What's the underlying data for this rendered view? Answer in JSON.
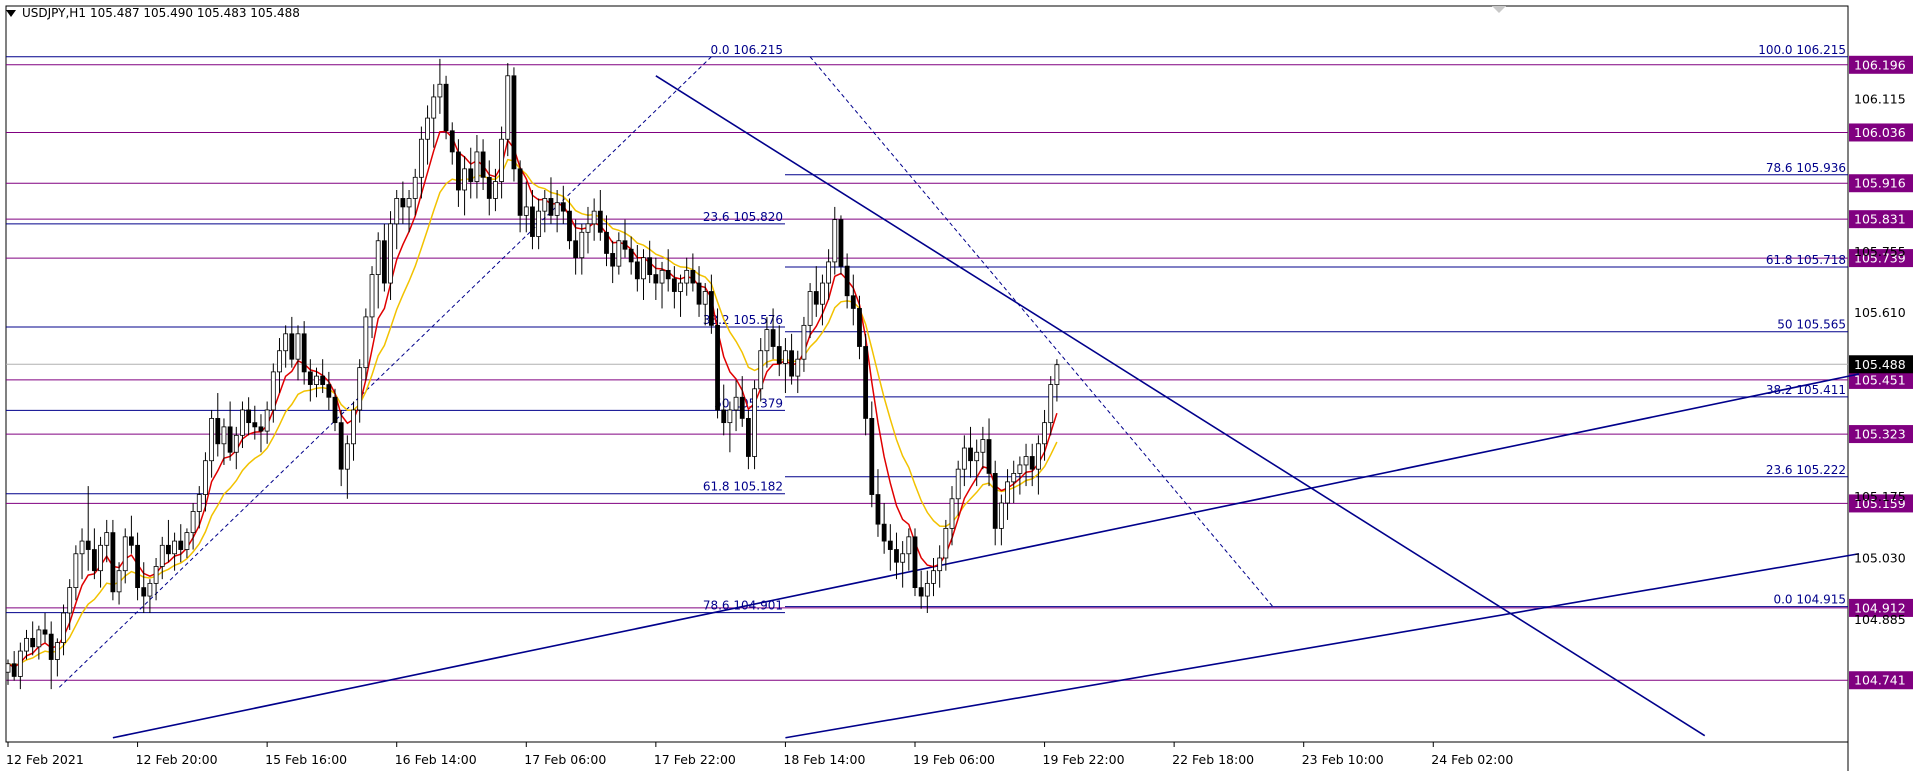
{
  "header": {
    "symbol_timeframe": "USDJPY,H1",
    "quote": "105.487 105.490 105.483 105.488"
  },
  "colors": {
    "bull": "#ffffff",
    "bear": "#000000",
    "ma_fast": "#e00000",
    "ma_slow": "#f2c200",
    "fib": "#00008b",
    "level": "#800080",
    "current_price": "#000000"
  },
  "chart_data": {
    "type": "candlestick",
    "symbol": "USDJPY",
    "timeframe": "H1",
    "ylim": [
      104.595,
      106.335
    ],
    "current_price": 105.488,
    "x_ticks": [
      {
        "label": "12 Feb 2021",
        "bar": 0
      },
      {
        "label": "12 Feb 20:00",
        "bar": 21
      },
      {
        "label": "15 Feb 16:00",
        "bar": 42
      },
      {
        "label": "16 Feb 14:00",
        "bar": 63
      },
      {
        "label": "17 Feb 06:00",
        "bar": 84
      },
      {
        "label": "17 Feb 22:00",
        "bar": 105
      },
      {
        "label": "18 Feb 14:00",
        "bar": 126
      },
      {
        "label": "19 Feb 06:00",
        "bar": 147
      },
      {
        "label": "19 Feb 22:00",
        "bar": 168
      },
      {
        "label": "22 Feb 18:00",
        "bar": 189
      },
      {
        "label": "23 Feb 10:00",
        "bar": 210
      },
      {
        "label": "24 Feb 02:00",
        "bar": 231
      }
    ],
    "y_axis_labels": [
      "106.115",
      "105.755",
      "105.610",
      "105.175",
      "105.030",
      "104.885"
    ],
    "price_levels": [
      {
        "label": "106.196",
        "value": 106.196
      },
      {
        "label": "106.036",
        "value": 106.036
      },
      {
        "label": "105.916",
        "value": 105.916
      },
      {
        "label": "105.831",
        "value": 105.831
      },
      {
        "label": "105.739",
        "value": 105.739
      },
      {
        "label": "105.451",
        "value": 105.451
      },
      {
        "label": "105.323",
        "value": 105.323
      },
      {
        "label": "105.159",
        "value": 105.159
      },
      {
        "label": "104.912",
        "value": 104.912
      },
      {
        "label": "104.741",
        "value": 104.741
      }
    ],
    "fib_retracements": [
      {
        "name": "fib-left",
        "anchor_high": {
          "bar": 114,
          "value": 106.215
        },
        "anchor_low": {
          "bar": 8,
          "value": 104.72
        },
        "levels": [
          {
            "label": "0.0 106.215",
            "value": 106.215
          },
          {
            "label": "23.6 105.820",
            "value": 105.82
          },
          {
            "label": "38.2 105.576",
            "value": 105.576
          },
          {
            "label": "50 105.379",
            "value": 105.379
          },
          {
            "label": "61.8 105.182",
            "value": 105.182
          },
          {
            "label": "78.6 104.901",
            "value": 104.901
          }
        ]
      },
      {
        "name": "fib-right",
        "anchor_high": {
          "bar": 130,
          "value": 106.215
        },
        "anchor_low": {
          "bar": 205,
          "value": 104.915
        },
        "levels": [
          {
            "label": "100.0 106.215",
            "value": 106.215
          },
          {
            "label": "78.6 105.936",
            "value": 105.936
          },
          {
            "label": "61.8 105.718",
            "value": 105.718
          },
          {
            "label": "50 105.565",
            "value": 105.565
          },
          {
            "label": "38.2 105.411",
            "value": 105.411
          },
          {
            "label": "23.6 105.222",
            "value": 105.222
          },
          {
            "label": "0.0 104.915",
            "value": 104.915
          }
        ]
      }
    ],
    "trend_lines": [
      {
        "name": "down-trend",
        "p1": {
          "bar": 105,
          "value": 106.17
        },
        "p2": {
          "bar": 275,
          "value": 104.61
        }
      },
      {
        "name": "up-trend-upper",
        "p1": {
          "bar": 17,
          "value": 104.605
        },
        "p2": {
          "bar": 300,
          "value": 105.465
        }
      },
      {
        "name": "up-trend-lower",
        "p1": {
          "bar": 126,
          "value": 104.605
        },
        "p2": {
          "bar": 300,
          "value": 105.04
        }
      }
    ],
    "candles": [
      [
        104.76,
        104.79,
        104.73,
        104.78
      ],
      [
        104.78,
        104.81,
        104.74,
        104.75
      ],
      [
        104.75,
        104.83,
        104.72,
        104.81
      ],
      [
        104.81,
        104.86,
        104.79,
        104.84
      ],
      [
        104.84,
        104.88,
        104.8,
        104.82
      ],
      [
        104.82,
        104.87,
        104.79,
        104.86
      ],
      [
        104.86,
        104.9,
        104.83,
        104.85
      ],
      [
        104.85,
        104.88,
        104.72,
        104.79
      ],
      [
        104.79,
        104.84,
        104.75,
        104.83
      ],
      [
        104.83,
        104.92,
        104.8,
        104.9
      ],
      [
        104.9,
        104.98,
        104.86,
        104.96
      ],
      [
        104.96,
        105.06,
        104.93,
        105.04
      ],
      [
        105.04,
        105.1,
        104.98,
        105.07
      ],
      [
        105.07,
        105.2,
        105.0,
        105.05
      ],
      [
        105.05,
        105.1,
        104.98,
        105.0
      ],
      [
        105.0,
        105.08,
        104.96,
        105.06
      ],
      [
        105.06,
        105.12,
        105.02,
        105.09
      ],
      [
        105.09,
        105.12,
        104.93,
        104.95
      ],
      [
        104.95,
        105.02,
        104.92,
        105.0
      ],
      [
        105.0,
        105.1,
        104.97,
        105.08
      ],
      [
        105.08,
        105.13,
        105.04,
        105.06
      ],
      [
        105.06,
        105.09,
        104.93,
        104.96
      ],
      [
        104.96,
        105.02,
        104.9,
        104.94
      ],
      [
        104.94,
        104.98,
        104.9,
        104.97
      ],
      [
        104.97,
        105.03,
        104.93,
        105.01
      ],
      [
        105.01,
        105.08,
        104.98,
        105.06
      ],
      [
        105.06,
        105.12,
        105.02,
        105.04
      ],
      [
        105.04,
        105.09,
        105.0,
        105.07
      ],
      [
        105.07,
        105.11,
        105.02,
        105.05
      ],
      [
        105.05,
        105.1,
        105.03,
        105.09
      ],
      [
        105.09,
        105.16,
        105.05,
        105.14
      ],
      [
        105.14,
        105.2,
        105.1,
        105.18
      ],
      [
        105.18,
        105.28,
        105.14,
        105.26
      ],
      [
        105.26,
        105.38,
        105.22,
        105.36
      ],
      [
        105.36,
        105.42,
        105.27,
        105.3
      ],
      [
        105.3,
        105.36,
        105.25,
        105.34
      ],
      [
        105.34,
        105.4,
        105.26,
        105.28
      ],
      [
        105.28,
        105.34,
        105.24,
        105.32
      ],
      [
        105.32,
        105.4,
        105.29,
        105.38
      ],
      [
        105.38,
        105.41,
        105.32,
        105.35
      ],
      [
        105.35,
        105.39,
        105.31,
        105.34
      ],
      [
        105.34,
        105.37,
        105.28,
        105.33
      ],
      [
        105.33,
        105.4,
        105.3,
        105.38
      ],
      [
        105.38,
        105.49,
        105.35,
        105.47
      ],
      [
        105.47,
        105.55,
        105.42,
        105.52
      ],
      [
        105.52,
        105.58,
        105.48,
        105.56
      ],
      [
        105.56,
        105.6,
        105.48,
        105.5
      ],
      [
        105.5,
        105.58,
        105.45,
        105.56
      ],
      [
        105.56,
        105.59,
        105.44,
        105.47
      ],
      [
        105.47,
        105.5,
        105.4,
        105.44
      ],
      [
        105.44,
        105.48,
        105.41,
        105.46
      ],
      [
        105.46,
        105.5,
        105.42,
        105.44
      ],
      [
        105.44,
        105.47,
        105.38,
        105.41
      ],
      [
        105.41,
        105.43,
        105.33,
        105.35
      ],
      [
        105.35,
        105.38,
        105.2,
        105.24
      ],
      [
        105.24,
        105.32,
        105.17,
        105.3
      ],
      [
        105.3,
        105.4,
        105.26,
        105.38
      ],
      [
        105.38,
        105.5,
        105.35,
        105.48
      ],
      [
        105.48,
        105.62,
        105.45,
        105.6
      ],
      [
        105.6,
        105.72,
        105.55,
        105.7
      ],
      [
        105.7,
        105.8,
        105.62,
        105.78
      ],
      [
        105.78,
        105.82,
        105.66,
        105.68
      ],
      [
        105.68,
        105.85,
        105.64,
        105.82
      ],
      [
        105.82,
        105.9,
        105.76,
        105.88
      ],
      [
        105.88,
        105.92,
        105.82,
        105.86
      ],
      [
        105.86,
        105.9,
        105.8,
        105.88
      ],
      [
        105.88,
        105.95,
        105.84,
        105.93
      ],
      [
        105.93,
        106.05,
        105.88,
        106.02
      ],
      [
        106.02,
        106.1,
        105.96,
        106.07
      ],
      [
        106.07,
        106.15,
        106.0,
        106.12
      ],
      [
        106.12,
        106.21,
        106.08,
        106.15
      ],
      [
        106.15,
        106.17,
        106.02,
        106.04
      ],
      [
        106.04,
        106.06,
        105.96,
        105.99
      ],
      [
        105.99,
        106.02,
        105.86,
        105.9
      ],
      [
        105.9,
        105.98,
        105.84,
        105.95
      ],
      [
        105.95,
        106.0,
        105.88,
        105.92
      ],
      [
        105.92,
        106.03,
        105.88,
        105.99
      ],
      [
        105.99,
        106.02,
        105.9,
        105.93
      ],
      [
        105.93,
        105.97,
        105.84,
        105.88
      ],
      [
        105.88,
        105.95,
        105.85,
        105.92
      ],
      [
        105.92,
        106.05,
        105.88,
        106.02
      ],
      [
        106.02,
        106.2,
        105.98,
        106.17
      ],
      [
        106.17,
        106.19,
        105.92,
        105.95
      ],
      [
        105.95,
        105.97,
        105.8,
        105.84
      ],
      [
        105.84,
        105.92,
        105.8,
        105.86
      ],
      [
        105.86,
        105.9,
        105.76,
        105.79
      ],
      [
        105.79,
        105.88,
        105.76,
        105.85
      ],
      [
        105.85,
        105.9,
        105.8,
        105.88
      ],
      [
        105.88,
        105.93,
        105.82,
        105.84
      ],
      [
        105.84,
        105.9,
        105.8,
        105.87
      ],
      [
        105.87,
        105.91,
        105.82,
        105.85
      ],
      [
        105.85,
        105.88,
        105.76,
        105.78
      ],
      [
        105.78,
        105.83,
        105.7,
        105.74
      ],
      [
        105.74,
        105.82,
        105.7,
        105.8
      ],
      [
        105.8,
        105.86,
        105.75,
        105.82
      ],
      [
        105.82,
        105.88,
        105.78,
        105.85
      ],
      [
        105.85,
        105.9,
        105.78,
        105.8
      ],
      [
        105.8,
        105.84,
        105.72,
        105.75
      ],
      [
        105.75,
        105.78,
        105.68,
        105.72
      ],
      [
        105.72,
        105.8,
        105.7,
        105.78
      ],
      [
        105.78,
        105.83,
        105.74,
        105.76
      ],
      [
        105.76,
        105.79,
        105.7,
        105.73
      ],
      [
        105.73,
        105.77,
        105.66,
        105.69
      ],
      [
        105.69,
        105.76,
        105.64,
        105.74
      ],
      [
        105.74,
        105.78,
        105.68,
        105.7
      ],
      [
        105.7,
        105.74,
        105.64,
        105.68
      ],
      [
        105.68,
        105.73,
        105.62,
        105.71
      ],
      [
        105.71,
        105.76,
        105.66,
        105.69
      ],
      [
        105.69,
        105.72,
        105.62,
        105.66
      ],
      [
        105.66,
        105.7,
        105.6,
        105.68
      ],
      [
        105.68,
        105.74,
        105.65,
        105.71
      ],
      [
        105.71,
        105.75,
        105.66,
        105.68
      ],
      [
        105.68,
        105.72,
        105.6,
        105.63
      ],
      [
        105.63,
        105.68,
        105.58,
        105.66
      ],
      [
        105.66,
        105.7,
        105.56,
        105.58
      ],
      [
        105.58,
        105.62,
        105.36,
        105.38
      ],
      [
        105.38,
        105.44,
        105.32,
        105.35
      ],
      [
        105.35,
        105.4,
        105.28,
        105.38
      ],
      [
        105.38,
        105.45,
        105.33,
        105.41
      ],
      [
        105.41,
        105.46,
        105.34,
        105.36
      ],
      [
        105.36,
        105.38,
        105.24,
        105.27
      ],
      [
        105.27,
        105.45,
        105.24,
        105.43
      ],
      [
        105.43,
        105.55,
        105.4,
        105.52
      ],
      [
        105.52,
        105.6,
        105.48,
        105.57
      ],
      [
        105.57,
        105.62,
        105.5,
        105.53
      ],
      [
        105.53,
        105.58,
        105.46,
        105.49
      ],
      [
        105.49,
        105.55,
        105.42,
        105.52
      ],
      [
        105.52,
        105.56,
        105.44,
        105.46
      ],
      [
        105.46,
        105.52,
        105.42,
        105.5
      ],
      [
        105.5,
        105.6,
        105.47,
        105.58
      ],
      [
        105.58,
        105.68,
        105.55,
        105.66
      ],
      [
        105.66,
        105.72,
        105.6,
        105.63
      ],
      [
        105.63,
        105.7,
        105.58,
        105.68
      ],
      [
        105.68,
        105.76,
        105.64,
        105.73
      ],
      [
        105.73,
        105.86,
        105.7,
        105.83
      ],
      [
        105.83,
        105.84,
        105.7,
        105.72
      ],
      [
        105.72,
        105.75,
        105.62,
        105.65
      ],
      [
        105.65,
        105.7,
        105.58,
        105.62
      ],
      [
        105.62,
        105.65,
        105.5,
        105.53
      ],
      [
        105.53,
        105.56,
        105.32,
        105.36
      ],
      [
        105.36,
        105.4,
        105.15,
        105.18
      ],
      [
        105.18,
        105.24,
        105.08,
        105.11
      ],
      [
        105.11,
        105.16,
        105.04,
        105.07
      ],
      [
        105.07,
        105.11,
        105.0,
        105.05
      ],
      [
        105.05,
        105.09,
        104.98,
        105.02
      ],
      [
        105.02,
        105.07,
        104.96,
        105.04
      ],
      [
        105.04,
        105.1,
        105.0,
        105.08
      ],
      [
        105.08,
        105.1,
        104.94,
        104.96
      ],
      [
        104.96,
        105.0,
        104.91,
        104.94
      ],
      [
        104.94,
        105.0,
        104.9,
        104.97
      ],
      [
        104.97,
        105.03,
        104.94,
        105.0
      ],
      [
        105.0,
        105.06,
        104.96,
        105.03
      ],
      [
        105.03,
        105.12,
        105.0,
        105.1
      ],
      [
        105.1,
        105.2,
        105.06,
        105.17
      ],
      [
        105.17,
        105.26,
        105.13,
        105.24
      ],
      [
        105.24,
        105.32,
        105.2,
        105.29
      ],
      [
        105.29,
        105.34,
        105.22,
        105.26
      ],
      [
        105.26,
        105.31,
        105.2,
        105.28
      ],
      [
        105.28,
        105.34,
        105.24,
        105.31
      ],
      [
        105.31,
        105.36,
        105.2,
        105.23
      ],
      [
        105.23,
        105.26,
        105.06,
        105.1
      ],
      [
        105.1,
        105.18,
        105.06,
        105.16
      ],
      [
        105.16,
        105.24,
        105.12,
        105.21
      ],
      [
        105.21,
        105.26,
        105.16,
        105.23
      ],
      [
        105.23,
        105.27,
        105.18,
        105.25
      ],
      [
        105.25,
        105.3,
        105.2,
        105.27
      ],
      [
        105.27,
        105.3,
        105.2,
        105.24
      ],
      [
        105.24,
        105.32,
        105.18,
        105.3
      ],
      [
        105.3,
        105.38,
        105.26,
        105.35
      ],
      [
        105.35,
        105.46,
        105.32,
        105.44
      ],
      [
        105.44,
        105.5,
        105.4,
        105.487
      ]
    ],
    "ma_fast_name": "",
    "ma_slow_name": ""
  }
}
